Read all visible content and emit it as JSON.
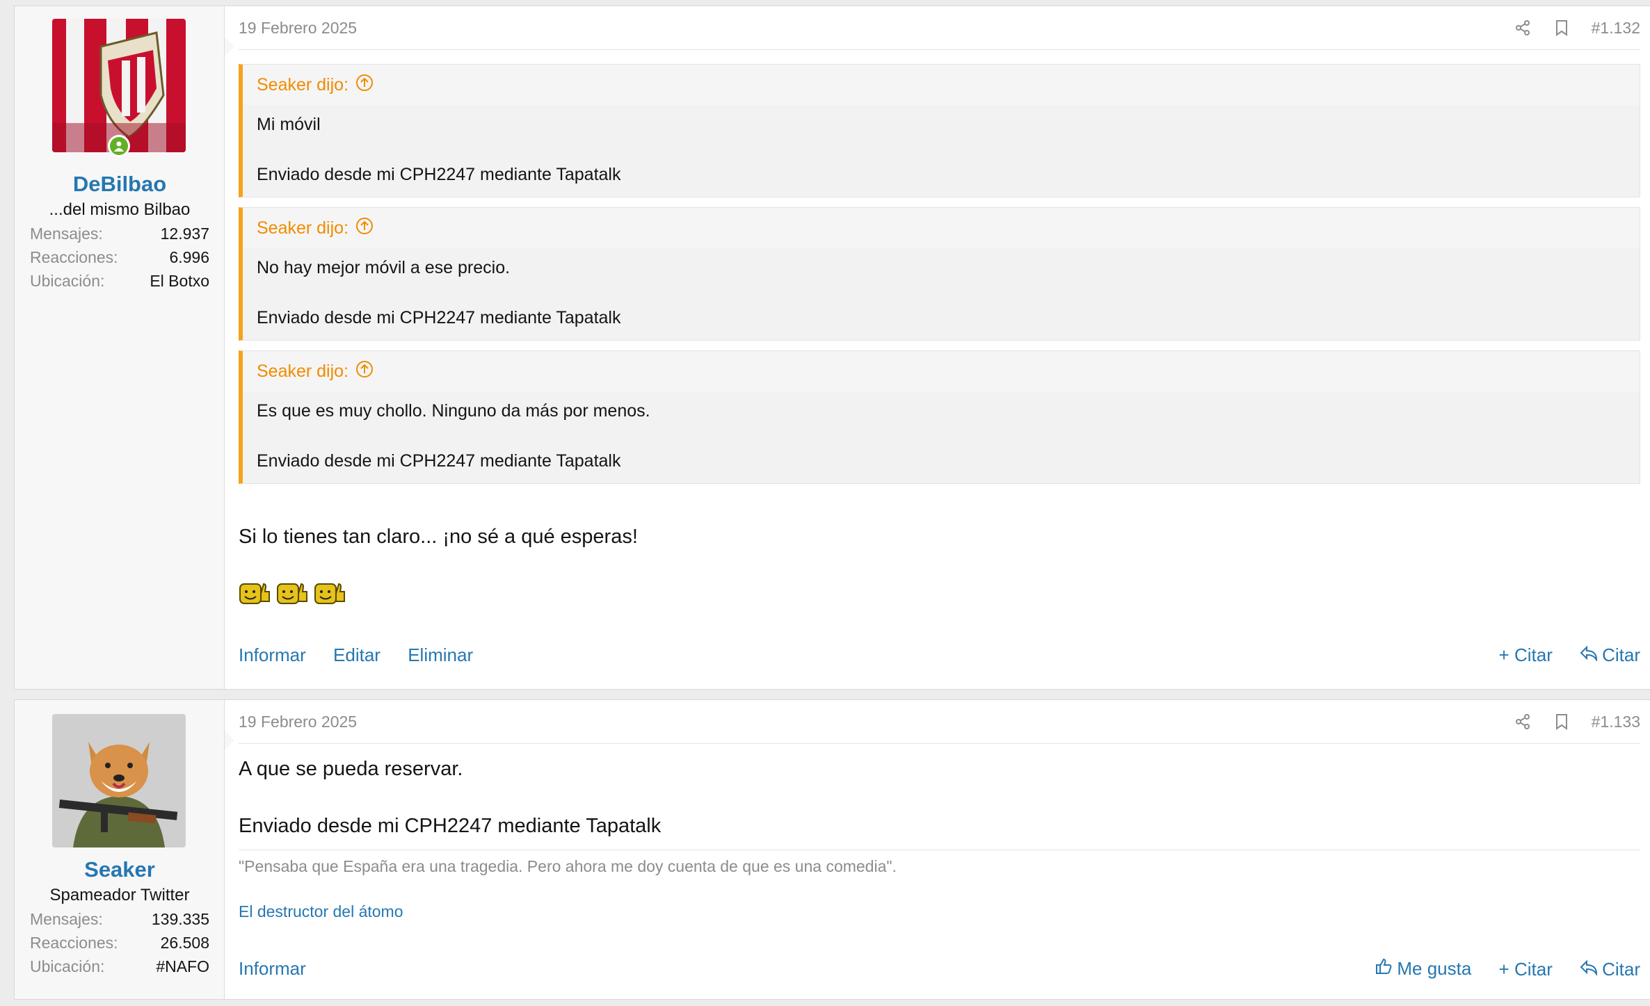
{
  "posts": [
    {
      "user": {
        "name": "DeBilbao",
        "title": "...del mismo Bilbao",
        "stats": [
          {
            "label": "Mensajes:",
            "value": "12.937"
          },
          {
            "label": "Reacciones:",
            "value": "6.996"
          },
          {
            "label": "Ubicación:",
            "value": "El Botxo"
          }
        ],
        "online": true
      },
      "date": "19 Febrero 2025",
      "number": "#1.132",
      "quotes": [
        {
          "author": "Seaker dijo:",
          "lines": [
            "Mi móvil",
            "Enviado desde mi CPH2247 mediante Tapatalk"
          ]
        },
        {
          "author": "Seaker dijo:",
          "lines": [
            "No hay mejor móvil a ese precio.",
            "Enviado desde mi CPH2247 mediante Tapatalk"
          ]
        },
        {
          "author": "Seaker dijo:",
          "lines": [
            "Es que es muy chollo. Ninguno da más por menos.",
            "Enviado desde mi CPH2247 mediante Tapatalk"
          ]
        }
      ],
      "message": "Si lo tienes tan claro... ¡no sé a qué esperas!",
      "actions_left": [
        "Informar",
        "Editar",
        "Eliminar"
      ],
      "actions_right": [
        "+ Citar",
        "Citar"
      ]
    },
    {
      "user": {
        "name": "Seaker",
        "title": "Spameador Twitter",
        "stats": [
          {
            "label": "Mensajes:",
            "value": "139.335"
          },
          {
            "label": "Reacciones:",
            "value": "26.508"
          },
          {
            "label": "Ubicación:",
            "value": "#NAFO"
          }
        ]
      },
      "date": "19 Febrero 2025",
      "number": "#1.133",
      "message_lines": [
        "A que se pueda reservar.",
        "Enviado desde mi CPH2247 mediante Tapatalk"
      ],
      "signature": "\"Pensaba que España era una tragedia. Pero ahora me doy cuenta de que es una comedia\".",
      "signature_link": "El destructor del átomo",
      "actions_left": [
        "Informar"
      ],
      "actions_right": [
        "Me gusta",
        "+ Citar",
        "Citar"
      ]
    }
  ],
  "colors": {
    "link": "#2577b1",
    "quote_accent": "#f7a21a",
    "quote_author": "#f08c00",
    "online": "#63b025"
  }
}
